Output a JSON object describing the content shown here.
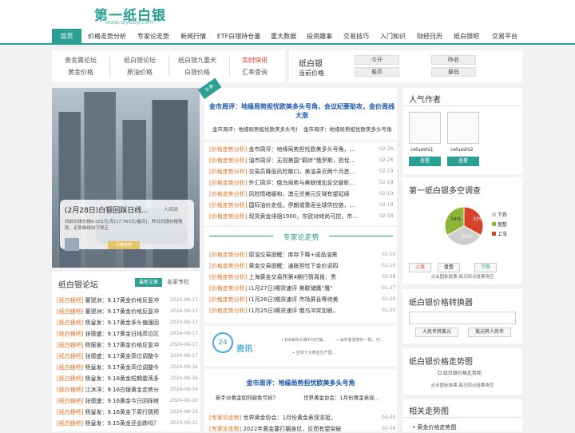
{
  "site": {
    "logo": "第一纸白银",
    "logo_sub": "www.diyizby.com"
  },
  "nav": [
    "首页",
    "价格走势分析",
    "专家论走势",
    "新闻行情",
    "ETF白银持仓量",
    "重大数据",
    "投资趣事",
    "交易技巧",
    "入门知识",
    "财经日历",
    "纸白银吧",
    "交易平台"
  ],
  "quick_links": [
    [
      "贵金属论坛",
      "黄金价格"
    ],
    [
      "纸白银论坛",
      "原油价格"
    ],
    [
      "纸白银九重天",
      "白银价格"
    ],
    [
      "实时快讯",
      "汇率查询"
    ]
  ],
  "price_panel": {
    "title": "纸白银",
    "subtitle": "当前价格",
    "open_label": "今开",
    "prev_label": "昨收",
    "high_label": "最高",
    "low_label": "最低"
  },
  "slider": {
    "caption": "(2月28日)白银回踩日线...",
    "desc": "目前白银价格6.001元/克(17.763元/盎司)，昨日白银价格强势，走势继续向下修正",
    "view_label": "人阅读",
    "more_label": "价格走势"
  },
  "forum": {
    "title": "纸白银论坛",
    "tab1": "最新文章",
    "tab2": "名家专栏",
    "rows": [
      {
        "tag": "[纸白银吧]",
        "text": "董锐洲：9.17黄金价格反复冲",
        "date": "2024-09-17"
      },
      {
        "tag": "[纸白银吧]",
        "text": "董锐洲：9.17黄金价格反复冲",
        "date": "2024-09-17"
      },
      {
        "tag": "[纸白银吧]",
        "text": "杨皇发：9.17黄金多头偏强回",
        "date": "2024-09-17"
      },
      {
        "tag": "[纸白银吧]",
        "text": "张德盛：9.17黄金日线高位区",
        "date": "2024-09-17"
      },
      {
        "tag": "[纸白银吧]",
        "text": "杨振宙：9.17黄金价格反复冲",
        "date": "2024-09-17"
      },
      {
        "tag": "[纸白银吧]",
        "text": "张德盛：9.17黄金高位调整今",
        "date": "2024-09-17"
      },
      {
        "tag": "[纸白银吧]",
        "text": "杨皇发：9.17黄金高位调整今",
        "date": "2024-09-16"
      },
      {
        "tag": "[纸白银吧]",
        "text": "杨皇发：9.16黄金短期震荡多",
        "date": "2024-09-16"
      },
      {
        "tag": "[纸白银吧]",
        "text": "江沐洋：9.16白银黄金走势分",
        "date": "2024-09-16"
      },
      {
        "tag": "[纸白银吧]",
        "text": "张德盛：9.16黄金今日回踩继",
        "date": "2024-09-16"
      },
      {
        "tag": "[纸白银吧]",
        "text": "杨皇发：9.16黄金下周行情预",
        "date": "2024-09-16"
      },
      {
        "tag": "[纸白银吧]",
        "text": "杨皇发：9.15黄金还会跌吗？",
        "date": "2024-09-15"
      }
    ]
  },
  "headline": {
    "badge": "头条",
    "title": "金市周评：地缘局势担忧欧美多头号角，会议纪要助攻，金价周线大涨",
    "sub1": "金市周评：地缘局势担忧欧美多头号角",
    "sub2": "金市周评：地缘局势担忧欧美多头号角"
  },
  "price_list": [
    {
      "tag": "[价格走势分析]",
      "text": "金市周评：地缘局势担忧欧美多头号角，...",
      "date": "02-26"
    },
    {
      "tag": "[价格走势分析]",
      "text": "油市周评：无视美国“羁绊”俄罗斯，担忧...",
      "date": "02-26"
    },
    {
      "tag": "[价格走势分析]",
      "text": "交易员降低风险敞口，美油录近两个月首...",
      "date": "02-19"
    },
    {
      "tag": "[价格走势分析]",
      "text": "外汇周评：俄乌局势与美联储加息交替影...",
      "date": "02-19"
    },
    {
      "tag": "[价格走势分析]",
      "text": "风险情绪缓和，澳元兑美元反弹有望延续",
      "date": "02-19"
    },
    {
      "tag": "[价格走势分析]",
      "text": "国际油价走低，伊朗或重返全球供应链，...",
      "date": "02-19"
    },
    {
      "tag": "[价格走势分析]",
      "text": "现货黄金徘徊1900，东欧对峙尚可控，市...",
      "date": "02-18"
    }
  ],
  "expert": {
    "title": "专家论走势",
    "rows": [
      {
        "tag": "[价格走势分析]",
        "text": "原油交易提醒：库存下降+成品油需",
        "date": "02-10"
      },
      {
        "tag": "[价格走势分析]",
        "text": "黄金交易提醒：通胀担忧下金价迎四",
        "date": "02-10"
      },
      {
        "tag": "[价格走势分析]",
        "text": "上海黄金交易所第4期行情周报：贵",
        "date": "02-08"
      },
      {
        "tag": "[价格走势分析]",
        "text": "(1月27日)期货速评 美联储鹰“鹰”",
        "date": "01-27"
      },
      {
        "tag": "[价格走势分析]",
        "text": "(1月26日)期货速评 市场屏息等待美",
        "date": "01-26"
      },
      {
        "tag": "[价格走势分析]",
        "text": "(1月25日)期货速评 俄乌冲突加剧，",
        "date": "01-25"
      }
    ]
  },
  "news_banner": {
    "num": "24",
    "label": "资讯",
    "l1": "• EIA库存大降479万桶…",
    "l2": "• 油市看涨意外一致，可…",
    "l3": "• 全球十大黄金生产国…"
  },
  "headline2": {
    "title": "金市周评：地缘局势担忧欧美多头号角",
    "sub1": "新手炒黄金如何避免亏损？",
    "sub2": "世界黄金协会：1月份黄金表现..."
  },
  "bottom_list": [
    {
      "tag": "[专家论走势]",
      "text": "世界黄金协会：1月份黄金表现坚挺，",
      "date": "02-09"
    },
    {
      "tag": "[专家论走势]",
      "text": "2022年黄金要打翻身仗，反而有望突破",
      "date": "02-06"
    }
  ],
  "authors": {
    "title": "人气作者",
    "names": [
      "celueshi1",
      "celueshi2"
    ],
    "view": "查看"
  },
  "poll": {
    "title": "第一纸白银多空调查",
    "pct_up": "33%",
    "pct_down": "34%",
    "pct_flat": "33%",
    "legend": [
      "下跌",
      "盘整",
      "上涨"
    ],
    "btns": [
      "上涨",
      "盘整",
      "下跌"
    ],
    "note": "点击图标投票,每日四点投票清空",
    "chart_data": {
      "type": "pie",
      "categories": [
        "上涨",
        "下跌",
        "盘整"
      ],
      "values": [
        33,
        34,
        33
      ],
      "colors": [
        "#d9412b",
        "#cfcfcf",
        "#8db53a"
      ]
    }
  },
  "converter": {
    "title": "纸白银价格转换器",
    "btn1": "人民币转美元",
    "btn2": "美元转人民币"
  },
  "trend": {
    "title": "纸白银价格走势图",
    "img_alt": "纸白银价格走势图",
    "note": "点击图标投票,每日四点投票清空"
  },
  "related": {
    "title": "相关走势图",
    "item": "黄金价格走势图"
  }
}
